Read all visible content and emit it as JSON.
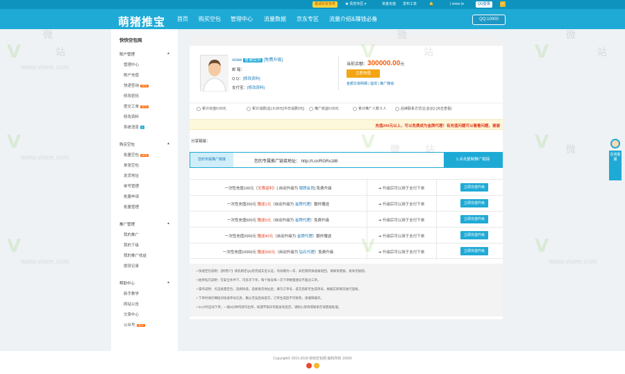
{
  "topbar": {
    "promo_label": "邀请好友有奖",
    "vip_menu": "贵宾专区",
    "recharge_link": "资金充值",
    "post_link": "发布工单",
    "user_label": "vioee",
    "qq_login": "QQ登录",
    "check": "✓"
  },
  "header": {
    "logo": "萌猪推宝",
    "nav": [
      "首页",
      "购买空包",
      "管理中心",
      "流量数据",
      "京东专区",
      "流量介绍&赚钱必备"
    ],
    "qq": "QQ:10000"
  },
  "sidebar": {
    "title": "快快空包网",
    "groups": [
      {
        "label": "账户管理",
        "items": [
          {
            "label": "管理中心"
          },
          {
            "label": "账户充值"
          },
          {
            "label": "快递查询",
            "new": "NEW"
          },
          {
            "label": "修改密码"
          },
          {
            "label": "提交工单",
            "new": "NEW"
          },
          {
            "label": "修改资料"
          },
          {
            "label": "系统消息",
            "num": "0"
          }
        ]
      },
      {
        "label": "购买空包",
        "items": [
          {
            "label": "批量空包",
            "new": "NEW"
          },
          {
            "label": "单张空包"
          },
          {
            "label": "发货地址"
          },
          {
            "label": "单号管理"
          },
          {
            "label": "批量申请"
          },
          {
            "label": "批量管理"
          }
        ]
      },
      {
        "label": "推广管理",
        "items": [
          {
            "label": "我的推广"
          },
          {
            "label": "我的下级"
          },
          {
            "label": "我的推广收益"
          },
          {
            "label": "提现记录"
          }
        ]
      },
      {
        "label": "帮助中心",
        "items": [
          {
            "label": "新手教学"
          },
          {
            "label": "网站公告"
          },
          {
            "label": "文章中心"
          },
          {
            "label": "公众号",
            "new": "NEW"
          }
        ]
      }
    ]
  },
  "user": {
    "name": "vioee",
    "level": "普通会员",
    "upgrade": "[免费升级]",
    "email_label": "邮    箱：",
    "email_val": "",
    "qq_label": "Q    Q：",
    "qq_val": "[修改资料]",
    "wx_label": "支付宝：",
    "wx_val": "[修改资料]",
    "balance_label": "当前余额：",
    "balance": "300000.00",
    "balance_unit": "元",
    "recharge_btn": "立即充值",
    "links": "金额交易明细  |  提现  |  推广赚钱"
  },
  "stats": [
    "累计充值0.00元",
    "累计消费(总):0.00元[今日消费0元]",
    "推广收益0.00元",
    "累计推广人数 0 人",
    "后续联系方式/企业QQ [点击查看]"
  ],
  "notice": "充值200元以上，可以免费成为金牌代理！有充值问题可以看看问题，谢谢",
  "share": {
    "heading": "分享链接：",
    "label": "您的专属推广链接",
    "url_prefix": "您的专属推广链接地址：",
    "url": "http://t.cn/RGRx188",
    "copy_btn": "1.点击复制推广链接"
  },
  "promos": [
    {
      "desc_a": "一次性充值100元（",
      "hl": "无限返利",
      "desc_b": "）[ 自动升级为 ",
      "hb": "银牌会员",
      "desc_c": "]  免费升级",
      "mid": "➔ 升级后可以用于支付下单",
      "btn": "立即充值升级"
    },
    {
      "desc_a": "一次性充值200元 ",
      "hl": "赠送1元",
      "desc_b": "（自动升级为 ",
      "hb": "金牌代理",
      "desc_c": "）额外赠送",
      "mid": "➔ 升级后可以用于支付下单",
      "btn": "立即充值升级"
    },
    {
      "desc_a": "一次性充值500元 ",
      "hl": "赠送5元",
      "desc_b": "（自动升级为 ",
      "hb": "金牌代理",
      "desc_c": "）免费升级",
      "mid": "➔ 升级后可以用于支付下单",
      "btn": "立即充值升级"
    },
    {
      "desc_a": "一次性充值2000元 ",
      "hl": "赠送40元",
      "desc_b": "（自动升级为 ",
      "hb": "金牌代理",
      "desc_c": "）额外赠送",
      "mid": "➔ 升级后可以用于支付下单",
      "btn": "立即充值升级"
    },
    {
      "desc_a": "一次性充值10000元 ",
      "hl": "赠送300元",
      "desc_b": "（自动升级为 ",
      "hb": "钻石代理",
      "desc_c": "）免费升级",
      "mid": "➔ 升级后可以用于支付下单",
      "btn": "立即充值升级"
    }
  ],
  "tips": [
    "快递空包说明：【新用户】请先绑定QQ及完成实名认证，有效期为一年，如在期内快递被退回，请联系客服，具体见规则。",
    "拍单技巧说明：在安全条件下，可多次下单，每个账号每一次下单数量建议不超过三单。",
    "操作说明：点击批量空包，选择快递，选择发货地址后，填写订单号，提交后即可生成单号，根据实际情况进行选择。",
    "下单时请仔细核对快递单号信息，确认无误后再提交，订单生成后不可修改，请谨慎操作。",
    "24小时自动下单，一般5分钟内即可出单，如遇节假日可能会有延迟，请耐心等待或联系在线客服处理。"
  ],
  "footer": {
    "copyright": "Copyright© 2015-2018 快快空包网 版权所有  10000"
  },
  "kefu": {
    "label": "在线客服"
  },
  "watermark": {
    "site": "www.vioee.com",
    "cn_a": "微",
    "cn_b": "站"
  },
  "colors": {
    "brand": "#1faad6",
    "accent": "#f3a514",
    "alert": "#e03a1a",
    "balance": "#f25c0a"
  }
}
